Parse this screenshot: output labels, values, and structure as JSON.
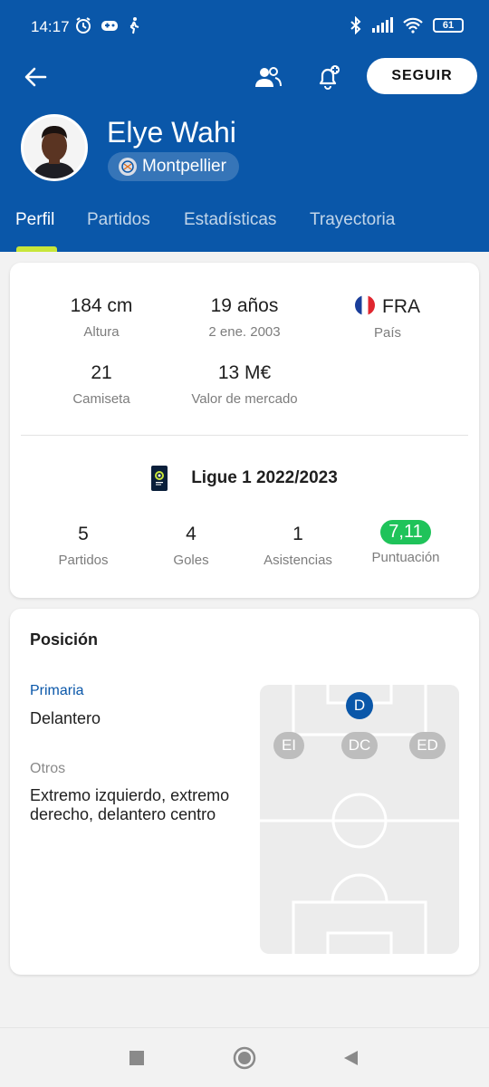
{
  "status": {
    "time": "14:17",
    "battery": "61",
    "left_icons": [
      "alarm-icon",
      "game-controller-icon",
      "walking-icon"
    ],
    "right_icons": [
      "bluetooth-icon",
      "signal-icon",
      "wifi-icon",
      "battery-icon"
    ]
  },
  "toolbar": {
    "follow_label": "SEGUIR"
  },
  "player": {
    "name": "Elye Wahi",
    "club": "Montpellier"
  },
  "tabs": [
    {
      "label": "Perfil",
      "active": true
    },
    {
      "label": "Partidos",
      "active": false
    },
    {
      "label": "Estadísticas",
      "active": false
    },
    {
      "label": "Trayectoria",
      "active": false
    }
  ],
  "info": {
    "height_value": "184 cm",
    "height_label": "Altura",
    "age_value": "19 años",
    "age_label": "2 ene. 2003",
    "country_value": "FRA",
    "country_label": "País",
    "shirt_value": "21",
    "shirt_label": "Camiseta",
    "market_value": "13 M€",
    "market_label": "Valor de mercado"
  },
  "league": {
    "title": "Ligue 1 2022/2023",
    "stats": [
      {
        "value": "5",
        "label": "Partidos"
      },
      {
        "value": "4",
        "label": "Goles"
      },
      {
        "value": "1",
        "label": "Asistencias"
      },
      {
        "value": "7,11",
        "label": "Puntuación"
      }
    ],
    "rating_color": "#1fc35a"
  },
  "position": {
    "title": "Posición",
    "primary_label": "Primaria",
    "primary_value": "Delantero",
    "others_label": "Otros",
    "others_value": "Extremo izquierdo, extremo derecho, delantero centro",
    "pitch_main": "D",
    "pitch_others": [
      "EI",
      "DC",
      "ED"
    ]
  },
  "colors": {
    "brand": "#0a57a9",
    "tab_indicator": "#c8e63a"
  }
}
